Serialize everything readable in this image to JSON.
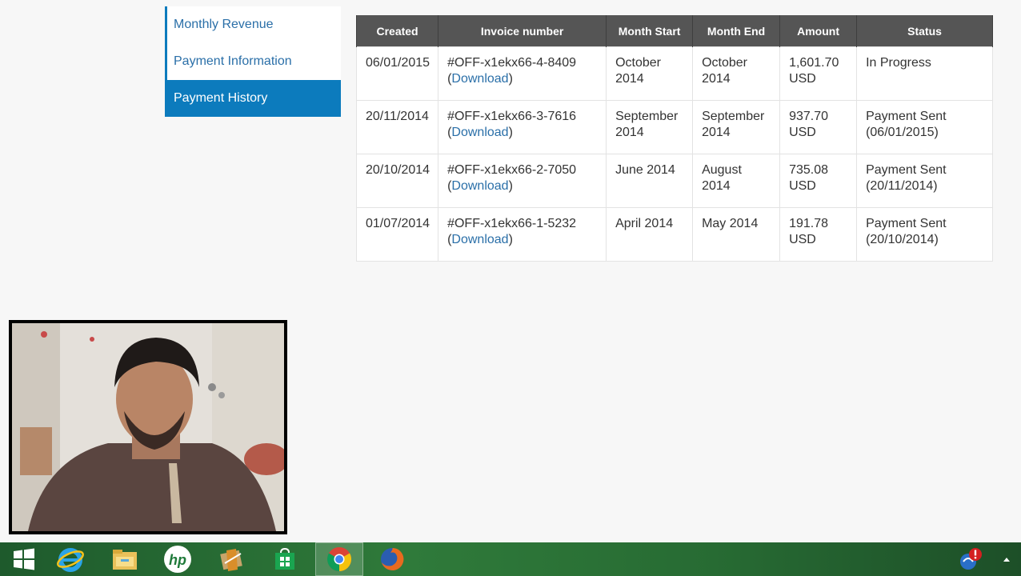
{
  "sidebar": {
    "items": [
      {
        "label": "Monthly Revenue"
      },
      {
        "label": "Payment Information"
      },
      {
        "label": "Payment History"
      }
    ]
  },
  "table": {
    "headers": [
      "Created",
      "Invoice number",
      "Month Start",
      "Month End",
      "Amount",
      "Status"
    ],
    "rows": [
      {
        "created": "06/01/2015",
        "invoice": "#OFF-x1ekx66-4-8409",
        "download": "Download",
        "month_start": "October 2014",
        "month_end": "October 2014",
        "amount": "1,601.70 USD",
        "status": "In Progress"
      },
      {
        "created": "20/11/2014",
        "invoice": "#OFF-x1ekx66-3-7616",
        "download": "Download",
        "month_start": "September 2014",
        "month_end": "September 2014",
        "amount": "937.70 USD",
        "status": "Payment Sent (06/01/2015)"
      },
      {
        "created": "20/10/2014",
        "invoice": "#OFF-x1ekx66-2-7050",
        "download": "Download",
        "month_start": "June 2014",
        "month_end": "August 2014",
        "amount": "735.08 USD",
        "status": "Payment Sent (20/11/2014)"
      },
      {
        "created": "01/07/2014",
        "invoice": "#OFF-x1ekx66-1-5232",
        "download": "Download",
        "month_start": "April 2014",
        "month_end": "May 2014",
        "amount": "191.78 USD",
        "status": "Payment Sent (20/10/2014)"
      }
    ]
  },
  "taskbar": {
    "icons": [
      "windows-start-icon",
      "internet-explorer-icon",
      "file-explorer-icon",
      "hp-icon",
      "media-app-icon",
      "windows-store-icon",
      "chrome-icon",
      "firefox-icon"
    ],
    "tray_icons": [
      "action-center-alert-icon",
      "show-hidden-icons-chevron"
    ]
  },
  "colors": {
    "accent": "#0c7bbd",
    "table_header": "#555555",
    "link": "#2a6fa8",
    "taskbar": "#2f7a3a"
  }
}
